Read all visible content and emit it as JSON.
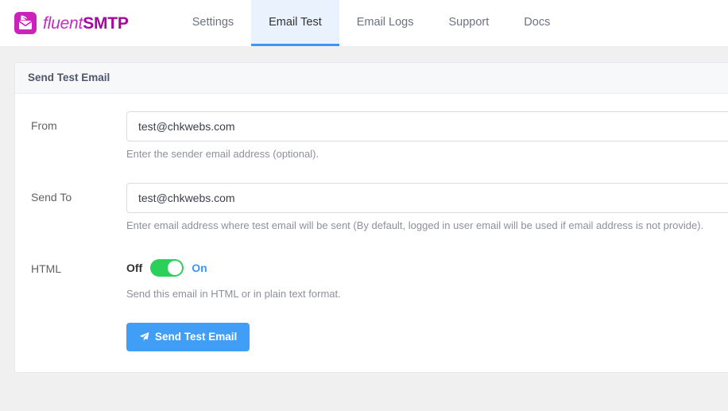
{
  "brand": {
    "logo_icon": "envelope-logo-icon",
    "name_light": "fluent",
    "name_bold": "SMTP",
    "logo_color": "#cc22bb"
  },
  "nav": {
    "items": [
      {
        "label": "Settings",
        "active": false
      },
      {
        "label": "Email Test",
        "active": true
      },
      {
        "label": "Email Logs",
        "active": false
      },
      {
        "label": "Support",
        "active": false
      },
      {
        "label": "Docs",
        "active": false
      }
    ],
    "active_color": "#3d96f3",
    "active_bg": "#eaf2fd"
  },
  "card": {
    "title": "Send Test Email",
    "rows": {
      "from": {
        "label": "From",
        "value": "test@chkwebs.com",
        "placeholder": "test@chkwebs.com",
        "help": "Enter the sender email address (optional)."
      },
      "send_to": {
        "label": "Send To",
        "value": "test@chkwebs.com",
        "placeholder": "test@chkwebs.com",
        "help": "Enter email address where test email will be sent (By default, logged in user email will be used if email address is not provide)."
      },
      "html": {
        "label": "HTML",
        "off_label": "Off",
        "on_label": "On",
        "state": "on",
        "help": "Send this email in HTML or in plain text format.",
        "on_color": "#2bd05a",
        "on_text_color": "#3d96f3"
      }
    },
    "submit": {
      "label": "Send Test Email",
      "icon": "paper-plane-icon",
      "color": "#419ef7"
    }
  }
}
